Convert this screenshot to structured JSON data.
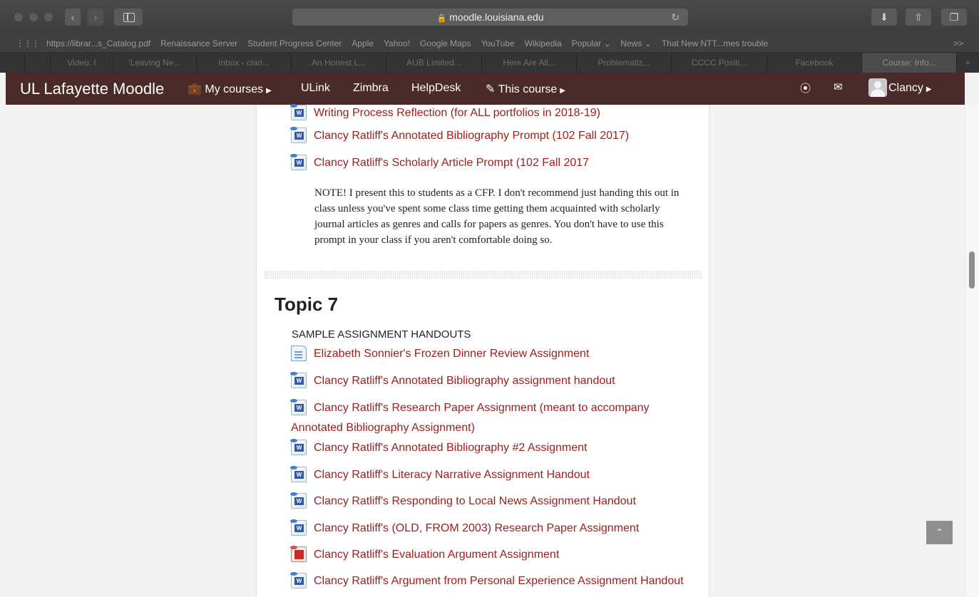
{
  "browser": {
    "url": "moodle.louisiana.edu",
    "bookmarks": [
      "https://librar...s_Catalog.pdf",
      "Renaissance Server",
      "Student Progress Center",
      "Apple",
      "Yahoo!",
      "Google Maps",
      "YouTube",
      "Wikipedia",
      "Popular ⌄",
      "News ⌄",
      "That New NTT...mes trouble"
    ],
    "bookmarks_more": ">>",
    "tabs": [
      "Video: I",
      "'Leaving Ne...",
      "Inbox - clan...",
      "An Honest L...",
      "AUB Limited...",
      "Here Are All...",
      "Problematiz...",
      "CCCC Positi...",
      "Facebook",
      "Course: Info..."
    ],
    "active_tab_index": 9
  },
  "navbar": {
    "brand": "UL Lafayette Moodle",
    "my_courses": "My courses",
    "ulink": "ULink",
    "zimbra": "Zimbra",
    "helpdesk": "HelpDesk",
    "this_course": "This course",
    "user": "Clancy",
    "bg_color": "#4a2a2a"
  },
  "section_top": {
    "activities": [
      {
        "label": "Writing Process Reflection (for ALL portfolios in 2018-19)",
        "icon": "word-doc-icon"
      },
      {
        "label": "Clancy Ratliff's Annotated Bibliography Prompt (102 Fall 2017)",
        "icon": "word-doc-icon"
      },
      {
        "label": "Clancy Ratliff's Scholarly Article Prompt (102 Fall 2017",
        "icon": "word-doc-icon"
      }
    ],
    "note": "NOTE! I present this to students as a CFP. I don't recommend just handing this out in class unless you've spent some class time getting them acquainted with scholarly journal articles as genres and calls for papers as genres. You don't have to use this prompt in your class if you aren't comfortable doing so."
  },
  "topic7": {
    "title": "Topic 7",
    "label": "SAMPLE ASSIGNMENT HANDOUTS",
    "activities": [
      {
        "label": "Elizabeth Sonnier's Frozen Dinner Review Assignment",
        "icon": "document-icon"
      },
      {
        "label": "Clancy Ratliff's Annotated Bibliography assignment handout",
        "icon": "word-doc-icon"
      },
      {
        "label_line1": "Clancy Ratliff's Research Paper Assignment (meant to accompany",
        "label_line2": "Annotated Bibliography Assignment)",
        "icon": "word-doc-icon"
      },
      {
        "label": "Clancy Ratliff's Annotated Bibliography #2 Assignment",
        "icon": "word-doc-icon"
      },
      {
        "label": "Clancy Ratliff's Literacy Narrative Assignment Handout",
        "icon": "word-doc-icon"
      },
      {
        "label": "Clancy Ratliff's Responding to Local News Assignment Handout",
        "icon": "word-doc-icon"
      },
      {
        "label": "Clancy Ratliff's (OLD, FROM 2003) Research Paper Assignment",
        "icon": "word-doc-icon"
      },
      {
        "label": "Clancy Ratliff's Evaluation Argument Assignment",
        "icon": "pdf-icon"
      },
      {
        "label": "Clancy Ratliff's Argument from Personal Experience Assignment Handout",
        "icon": "word-doc-icon"
      }
    ]
  },
  "link_color": "#9a1d1d"
}
